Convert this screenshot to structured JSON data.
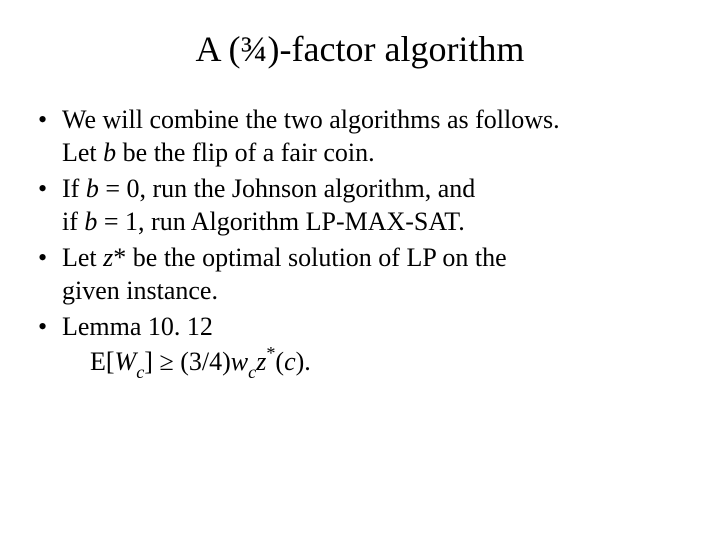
{
  "title": "A (¾)-factor algorithm",
  "bullets": {
    "b1a": "We will combine the two algorithms as follows.",
    "b1b_pre": "Let ",
    "b1b_var": "b",
    "b1b_post": " be the flip of a fair coin.",
    "b2a_pre": "If ",
    "b2a_var": "b",
    "b2a_eq": " = 0, run the Johnson algorithm, and",
    "b2b_pre": "if ",
    "b2b_var": "b",
    "b2b_eq": " = 1, run Algorithm LP-MAX-SAT.",
    "b3_pre": "Let ",
    "b3_var": "z",
    "b3_star": "*",
    "b3_post": " be the optimal solution of LP on the",
    "b3_line2": "given instance.",
    "b4_lemma": "Lemma 10. 12",
    "b4_E": "E[",
    "b4_W": "W",
    "b4_c1": "c",
    "b4_mid": "] ≥ (3/4)",
    "b4_w": "w",
    "b4_c2": "c",
    "b4_z": "z",
    "b4_star": "*",
    "b4_open": "(",
    "b4_c3": "c",
    "b4_close": ")."
  }
}
